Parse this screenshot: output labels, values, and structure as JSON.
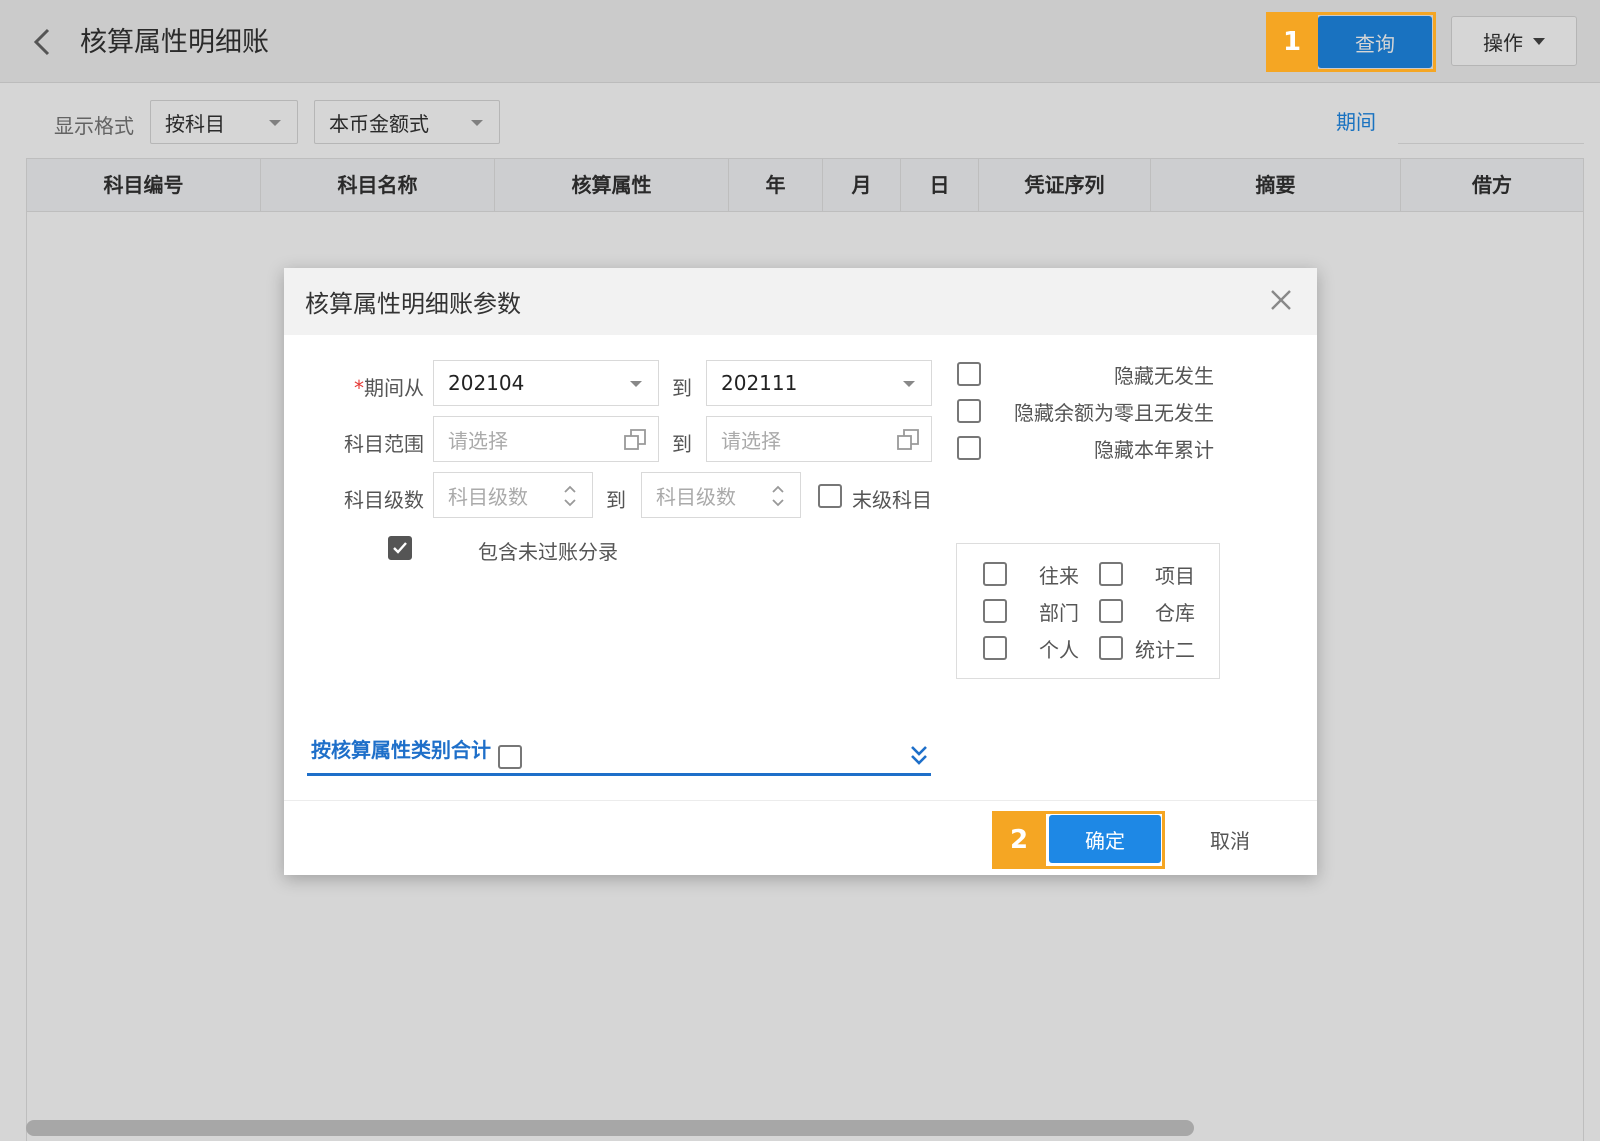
{
  "header": {
    "title": "核算属性明细账",
    "query_label": "查询",
    "ops_label": "操作"
  },
  "filters": {
    "display_label": "显示格式",
    "format_select": "按科目",
    "amount_select": "本币金额式",
    "period_link": "期间"
  },
  "table": {
    "columns": [
      "科目编号",
      "科目名称",
      "核算属性",
      "年",
      "月",
      "日",
      "凭证序列",
      "摘要",
      "借方"
    ]
  },
  "dialog": {
    "title": "核算属性明细账参数",
    "required_mark": "*",
    "period_label": "期间从",
    "period_from": "202104",
    "period_to": "202111",
    "to_label": "到",
    "subject_range_label": "科目范围",
    "subject_range_placeholder": "请选择",
    "subject_level_label": "科目级数",
    "subject_level_placeholder": "科目级数",
    "leaf_only_label": "末级科目",
    "include_unposted_label": "包含未过账分录",
    "hide_options": [
      "隐藏无发生",
      "隐藏余额为零且无发生",
      "隐藏本年累计"
    ],
    "attributes": [
      "往来",
      "项目",
      "部门",
      "仓库",
      "个人",
      "统计二"
    ],
    "sum_by_category_label": "按核算属性类别合计",
    "ok_label": "确定",
    "cancel_label": "取消"
  },
  "callouts": {
    "one": "1",
    "two": "2",
    "color": "#f5a623"
  },
  "colors": {
    "primary": "#1e88e5",
    "link": "#1e6fc9"
  }
}
